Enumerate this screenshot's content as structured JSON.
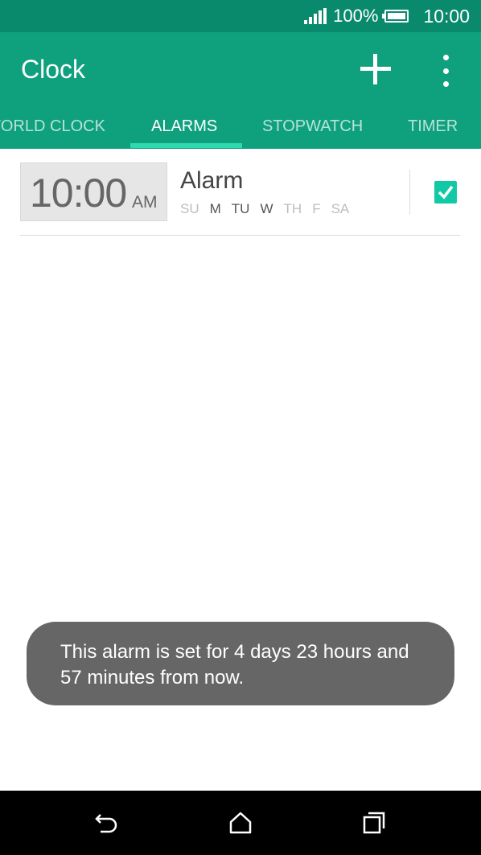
{
  "status_bar": {
    "battery_text": "100%",
    "time": "10:00",
    "icons": [
      "signal-icon",
      "battery-icon"
    ]
  },
  "app_bar": {
    "title": "Clock",
    "actions": [
      "add-icon",
      "more-vertical-icon"
    ],
    "background": "#0fa07e"
  },
  "tabs": [
    {
      "label": "WORLD CLOCK",
      "active": false
    },
    {
      "label": "ALARMS",
      "active": true
    },
    {
      "label": "STOPWATCH",
      "active": false
    },
    {
      "label": "TIMER",
      "active": false
    }
  ],
  "alarm": {
    "time": "10:00",
    "ampm": "AM",
    "label": "Alarm",
    "days": [
      {
        "label": "SU",
        "enabled": false
      },
      {
        "label": "M",
        "enabled": true
      },
      {
        "label": "TU",
        "enabled": true
      },
      {
        "label": "W",
        "enabled": true
      },
      {
        "label": "TH",
        "enabled": false
      },
      {
        "label": "F",
        "enabled": false
      },
      {
        "label": "SA",
        "enabled": false
      }
    ],
    "enabled": true,
    "accent": "#12c9a5"
  },
  "toast": {
    "message": "This alarm is set for 4 days 23 hours and 57 minutes from now."
  },
  "nav_bar": {
    "icons": [
      "back-icon",
      "home-icon",
      "recents-icon"
    ]
  }
}
